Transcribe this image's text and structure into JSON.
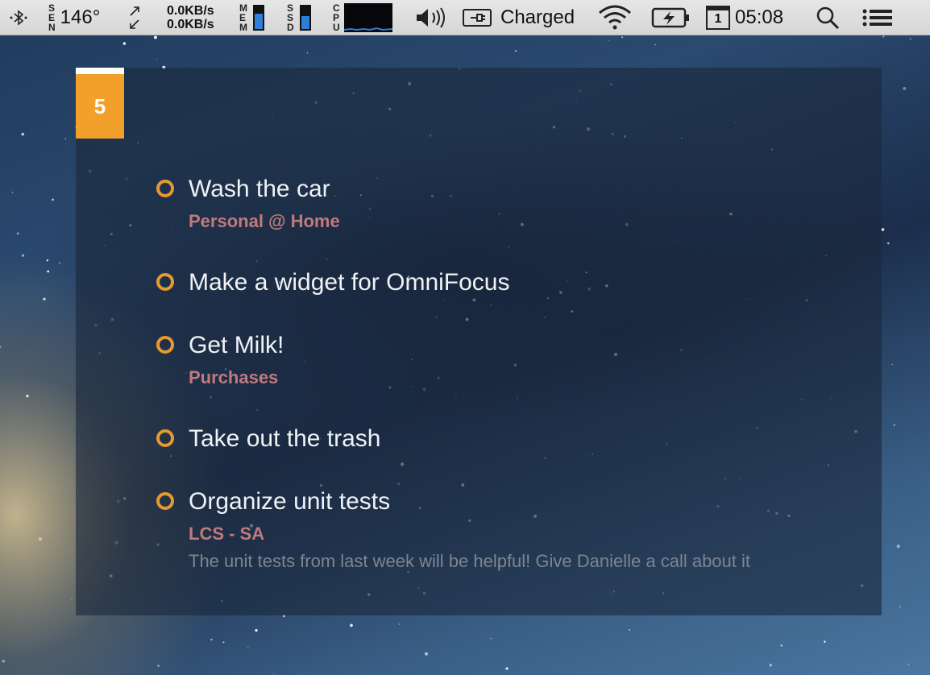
{
  "menubar": {
    "sensor_label": "SEN",
    "temperature": "146°",
    "net_up": "0.0KB/s",
    "net_down": "0.0KB/s",
    "mem_label": "MEM",
    "mem_level": 0.62,
    "ssd_label": "SSD",
    "ssd_level": 0.55,
    "cpu_label": "CPU",
    "power_status": "Charged",
    "calendar_day": "1",
    "clock": "05:08",
    "accent": "#2d7fd7"
  },
  "widget": {
    "count": "5",
    "badge_color": "#f2a02a",
    "tasks": [
      {
        "title": "Wash the car",
        "context": "Personal @ Home",
        "note": ""
      },
      {
        "title": "Make a widget for OmniFocus",
        "context": "",
        "note": ""
      },
      {
        "title": "Get Milk!",
        "context": "Purchases",
        "note": ""
      },
      {
        "title": "Take out the trash",
        "context": "",
        "note": ""
      },
      {
        "title": "Organize unit tests",
        "context": "LCS - SA",
        "note": "The unit tests from last week will be helpful! Give Danielle a call about it"
      }
    ]
  },
  "colors": {
    "circle": "#e69a2e",
    "context_text": "#c07a7e",
    "note_text": "#7d8590"
  }
}
